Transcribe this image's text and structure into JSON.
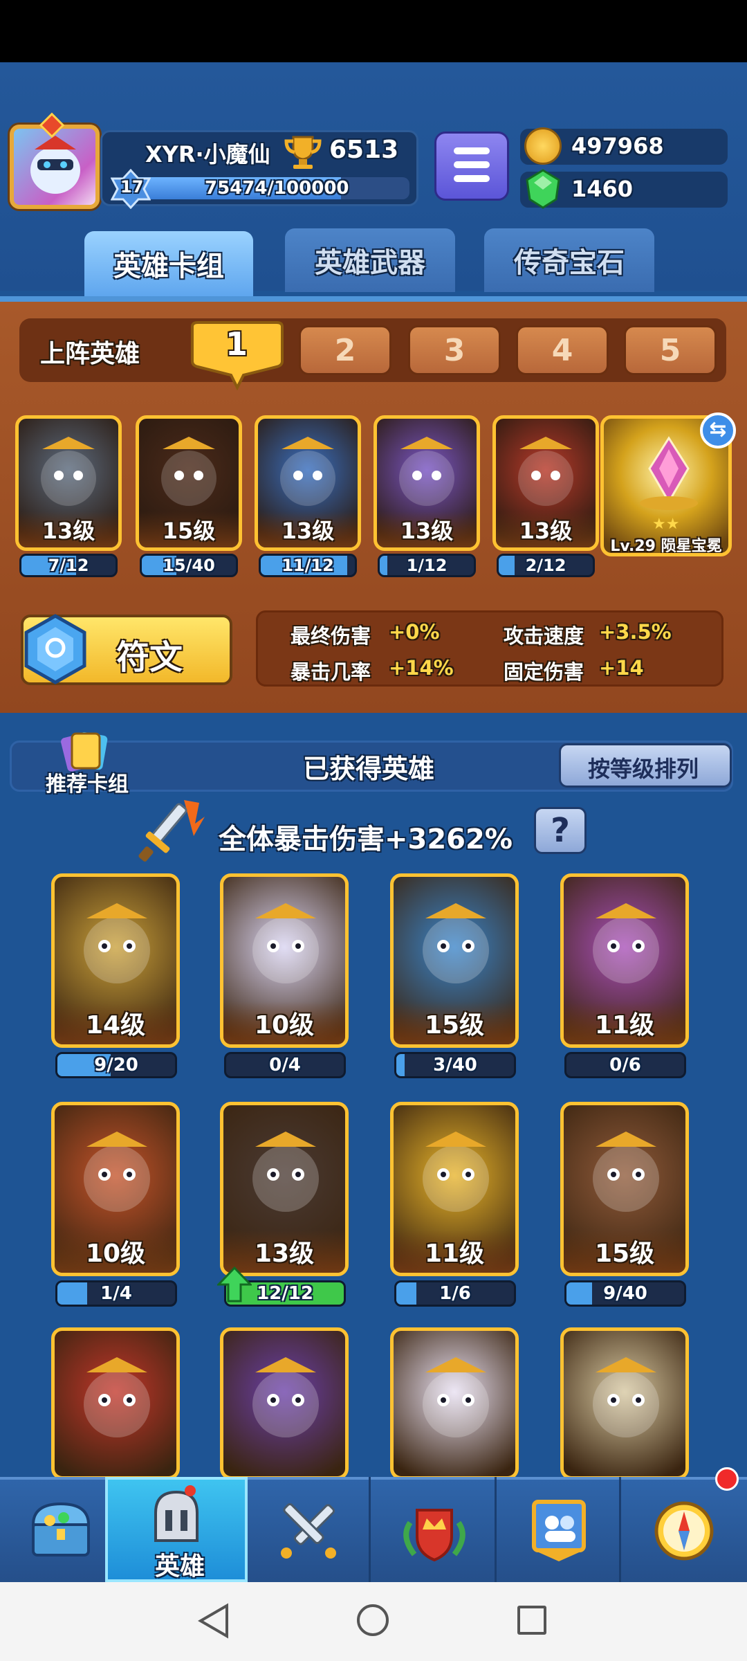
{
  "player": {
    "name": "XYR·小魔仙",
    "level": "17",
    "exp": "75474/100000",
    "exp_fraction": 0.755,
    "trophies": "6513"
  },
  "resources": {
    "gold": "497968",
    "gems": "1460"
  },
  "tabs": [
    {
      "label": "英雄卡组",
      "active": true
    },
    {
      "label": "英雄武器",
      "active": false
    },
    {
      "label": "传奇宝石",
      "active": false
    }
  ],
  "deck": {
    "label": "上阵英雄",
    "slots": [
      "1",
      "2",
      "3",
      "4",
      "5"
    ],
    "active_slot": "1",
    "heroes": [
      {
        "level": "13级",
        "progress": "7/12",
        "fill": 0.58,
        "color": "#5c6b7e"
      },
      {
        "level": "15级",
        "progress": "15/40",
        "fill": 0.37,
        "color": "#4b2a1a"
      },
      {
        "level": "13级",
        "progress": "11/12",
        "fill": 0.92,
        "color": "#3a6fbf"
      },
      {
        "level": "13级",
        "progress": "1/12",
        "fill": 0.08,
        "color": "#7a56c4"
      },
      {
        "level": "13级",
        "progress": "2/12",
        "fill": 0.17,
        "color": "#b83a2a"
      }
    ],
    "gem": {
      "label": "Lv.29 陨星宝冕"
    }
  },
  "rune": {
    "button_label": "符文",
    "stats": [
      {
        "label": "最终伤害",
        "value": "+0%"
      },
      {
        "label": "攻击速度",
        "value": "+3.5%"
      },
      {
        "label": "暴击几率",
        "value": "+14%"
      },
      {
        "label": "固定伤害",
        "value": "+14"
      }
    ]
  },
  "owned": {
    "recommend_label": "推荐卡组",
    "title": "已获得英雄",
    "sort_label": "按等级排列",
    "crit_text": "全体暴击伤害+3262%",
    "help": "?",
    "heroes": [
      {
        "level": "14级",
        "progress": "9/20",
        "fill": 0.45,
        "color": "#c9a03a"
      },
      {
        "level": "10级",
        "progress": "0/4",
        "fill": 0,
        "color": "#d9d4f2"
      },
      {
        "level": "15级",
        "progress": "3/40",
        "fill": 0.07,
        "color": "#3a84c9"
      },
      {
        "level": "11级",
        "progress": "0/6",
        "fill": 0,
        "color": "#a84fb8"
      },
      {
        "level": "10级",
        "progress": "1/4",
        "fill": 0.25,
        "color": "#c4532a"
      },
      {
        "level": "13级",
        "progress": "12/12",
        "fill": 1,
        "color": "#4a3a33",
        "upgrade": true
      },
      {
        "level": "11级",
        "progress": "1/6",
        "fill": 0.17,
        "color": "#e8b42a"
      },
      {
        "level": "15级",
        "progress": "9/40",
        "fill": 0.22,
        "color": "#8f5a3a"
      },
      {
        "level": "",
        "progress": "",
        "fill": 0,
        "color": "#c2362a"
      },
      {
        "level": "",
        "progress": "",
        "fill": 0,
        "color": "#6a3fa8"
      },
      {
        "level": "",
        "progress": "",
        "fill": 0,
        "color": "#e8e0f2"
      },
      {
        "level": "",
        "progress": "",
        "fill": 0,
        "color": "#d6c7a0"
      }
    ]
  },
  "nav": {
    "items": [
      {
        "icon": "treasure-chest-icon",
        "label": ""
      },
      {
        "icon": "helmet-icon",
        "label": "英雄",
        "active": true
      },
      {
        "icon": "crossed-swords-icon",
        "label": ""
      },
      {
        "icon": "crown-shield-icon",
        "label": ""
      },
      {
        "icon": "guild-banner-icon",
        "label": ""
      },
      {
        "icon": "compass-icon",
        "label": "",
        "badge": true
      }
    ]
  },
  "colors": {
    "accent": "#ffc232",
    "panel_brown": "#9a4c22",
    "bg_blue": "#1e5494"
  }
}
